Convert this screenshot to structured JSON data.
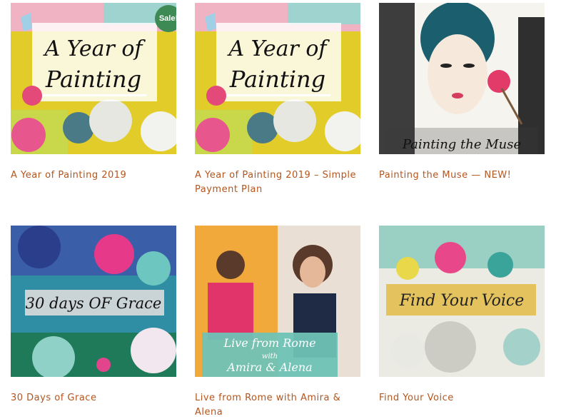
{
  "products": [
    {
      "title": "A Year of Painting 2019",
      "badge": "Sale!",
      "art_line1": "A Year of",
      "art_line2": "Painting"
    },
    {
      "title": "A Year of Painting 2019 – Simple Payment Plan",
      "art_line1": "A Year of",
      "art_line2": "Painting"
    },
    {
      "title": "Painting the Muse — NEW!",
      "art_caption": "Painting the Muse"
    },
    {
      "title": "30 Days of Grace",
      "art_caption": "30 days OF Grace"
    },
    {
      "title": "Live from Rome with Amira & Alena",
      "art_line1": "Live from Rome",
      "art_line2": "with",
      "art_line3": "Amira & Alena"
    },
    {
      "title": "Find Your Voice",
      "art_caption": "Find Your Voice"
    }
  ],
  "colors": {
    "title": "#b5551d",
    "sale_badge": "#3e8a55"
  }
}
